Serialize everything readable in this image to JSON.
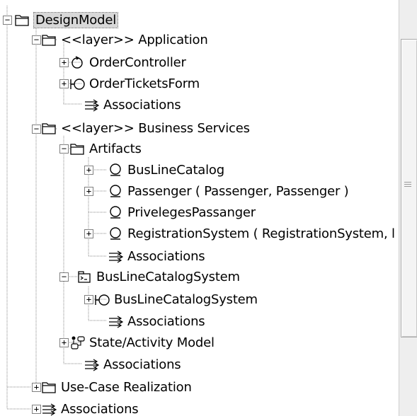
{
  "tree": {
    "root": {
      "label": "DesignModel"
    },
    "items": [
      {
        "label": "<<layer>> Application"
      },
      {
        "label": "OrderController"
      },
      {
        "label": "OrderTicketsForm"
      },
      {
        "label": "Associations"
      },
      {
        "label": "<<layer>> Business Services"
      },
      {
        "label": "Artifacts"
      },
      {
        "label": "BusLineCatalog"
      },
      {
        "label": "Passenger ( Passenger, Passenger )"
      },
      {
        "label": "PrivelegesPassanger"
      },
      {
        "label": "RegistrationSystem ( RegistrationSystem, l"
      },
      {
        "label": "Associations"
      },
      {
        "label": "BusLineCatalogSystem"
      },
      {
        "label": "BusLineCatalogSystem"
      },
      {
        "label": "Associations"
      },
      {
        "label": "State/Activity Model"
      },
      {
        "label": "Associations"
      },
      {
        "label": "Use-Case Realization"
      },
      {
        "label": "Associations"
      }
    ],
    "expander": {
      "collapsed": "+",
      "expanded": "−"
    }
  },
  "icons": {
    "folder": "folder-icon",
    "control": "control-class-icon",
    "boundary": "boundary-class-icon",
    "entity": "entity-class-icon",
    "associations": "associations-icon",
    "package": "package-icon",
    "statechart": "state-activity-model-icon"
  }
}
